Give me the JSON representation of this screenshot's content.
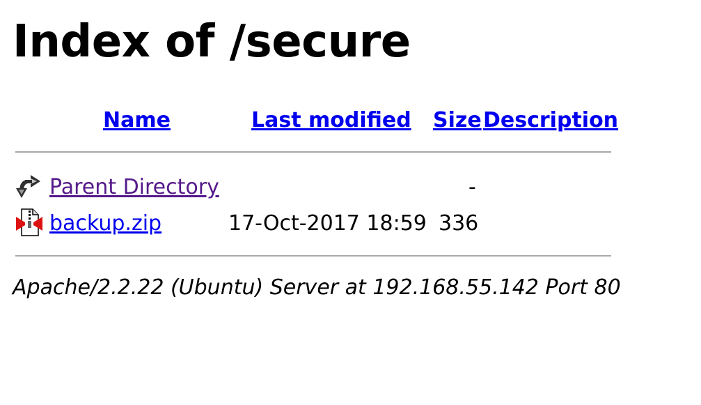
{
  "page": {
    "title": "Index of /secure"
  },
  "table": {
    "headers": {
      "name": "Name",
      "last_modified": "Last modified",
      "size": "Size",
      "description": "Description"
    },
    "rows": [
      {
        "icon": "back-arrow-icon",
        "name": "Parent Directory",
        "last_modified": "",
        "size": "-",
        "description": ""
      },
      {
        "icon": "compressed-file-icon",
        "name": "backup.zip",
        "last_modified": "17-Oct-2017 18:59",
        "size": "336",
        "description": ""
      }
    ]
  },
  "footer": {
    "server_signature": "Apache/2.2.22 (Ubuntu) Server at 192.168.55.142 Port 80"
  },
  "colors": {
    "link": "#0000ee",
    "visited_link": "#551a8b",
    "rule": "#a8a8a8",
    "background": "#ffffff"
  }
}
